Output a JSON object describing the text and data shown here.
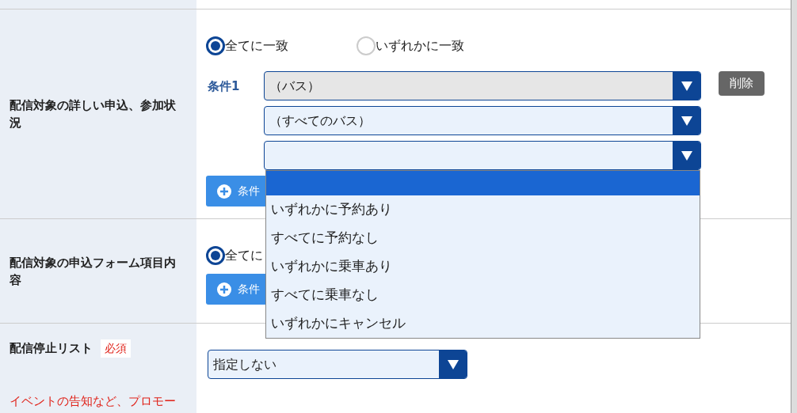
{
  "sections": [
    {
      "kind": "conditions",
      "label": "配信対象の詳しい申込、参加状況",
      "match_options": [
        {
          "label": "全てに一致",
          "selected": true
        },
        {
          "label": "いずれかに一致",
          "selected": false
        }
      ],
      "condition_label": "条件1",
      "selects": [
        {
          "value": "（バス）",
          "disabled": true
        },
        {
          "value": "（すべてのバス）",
          "disabled": false
        },
        {
          "disabled": false,
          "expanded": true
        }
      ],
      "delete_button": "削除",
      "dropdown_options": [
        {
          "selected": true
        },
        {
          "label": "いずれかに予約あり",
          "selected": false
        },
        {
          "label": "すべてに予約なし",
          "selected": false
        },
        {
          "label": "いずれかに乗車あり",
          "selected": false
        },
        {
          "label": "すべてに乗車なし",
          "selected": false
        },
        {
          "label": "いずれかにキャンセル",
          "selected": false
        }
      ],
      "add_button": "条件"
    },
    {
      "kind": "form_items",
      "label": "配信対象の申込フォーム項目内容",
      "match_options": [
        {
          "label": "全てに",
          "selected": true
        }
      ],
      "add_button": "条件"
    },
    {
      "kind": "stoplist",
      "label": "配信停止リスト",
      "badge": "必須",
      "select": {
        "value": "指定しない"
      },
      "note": "イベントの告知など、プロモー"
    }
  ]
}
